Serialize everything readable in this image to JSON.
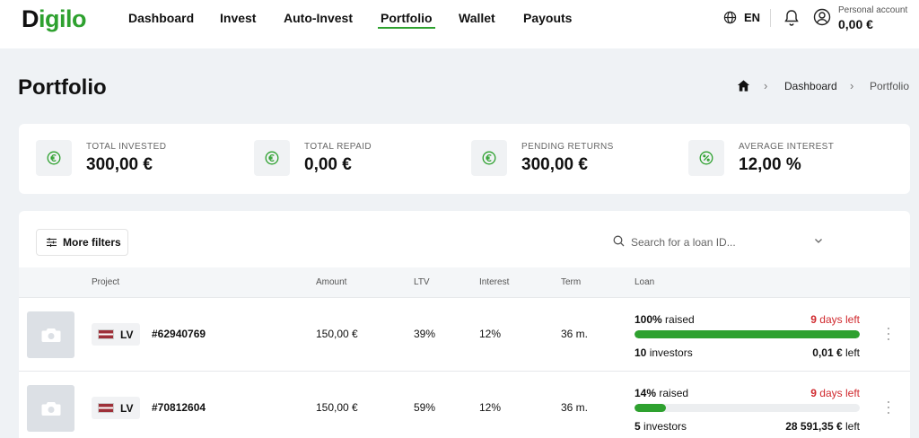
{
  "brand": {
    "name_prefix": "D",
    "name_rest": "igilo",
    "accent": "#2ea12f"
  },
  "nav": {
    "items": [
      {
        "label": "Dashboard"
      },
      {
        "label": "Invest"
      },
      {
        "label": "Auto-Invest"
      },
      {
        "label": "Portfolio",
        "active": true
      },
      {
        "label": "Wallet"
      },
      {
        "label": "Payouts"
      }
    ],
    "language": "EN",
    "account_label": "Personal account",
    "account_value": "0,00 €"
  },
  "header": {
    "title": "Portfolio",
    "breadcrumb": [
      "Dashboard",
      "Portfolio"
    ],
    "breadcrumb_sep": "›"
  },
  "stats": [
    {
      "label": "TOTAL INVESTED",
      "value": "300,00 €",
      "icon": "euro-icon"
    },
    {
      "label": "TOTAL REPAID",
      "value": "0,00 €",
      "icon": "euro-icon"
    },
    {
      "label": "PENDING RETURNS",
      "value": "300,00 €",
      "icon": "euro-icon"
    },
    {
      "label": "AVERAGE INTEREST",
      "value": "12,00 %",
      "icon": "percent-icon"
    }
  ],
  "toolbar": {
    "filters_label": "More filters",
    "search_placeholder": "Search for a loan ID..."
  },
  "table": {
    "columns": [
      "Project",
      "Amount",
      "LTV",
      "Interest",
      "Term",
      "Loan"
    ],
    "rows": [
      {
        "country": "LV",
        "loan_id": "#62940769",
        "amount": "150,00 €",
        "ltv": "39%",
        "interest": "12%",
        "term": "36 m.",
        "raised_pct": "100%",
        "raised_word": " raised",
        "raised_fraction": 1.0,
        "days_num": "9",
        "days_word": " days left",
        "investors_num": "10",
        "investors_word": " investors",
        "left_amount": "0,01 €",
        "left_word": " left"
      },
      {
        "country": "LV",
        "loan_id": "#70812604",
        "amount": "150,00 €",
        "ltv": "59%",
        "interest": "12%",
        "term": "36 m.",
        "raised_pct": "14%",
        "raised_word": " raised",
        "raised_fraction": 0.14,
        "days_num": "9",
        "days_word": " days left",
        "investors_num": "5",
        "investors_word": " investors",
        "left_amount": "28 591,35 €",
        "left_word": " left"
      }
    ]
  }
}
